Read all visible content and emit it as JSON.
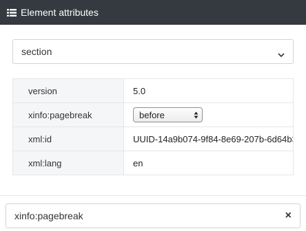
{
  "header": {
    "title": "Element attributes",
    "icon": "list-icon"
  },
  "element_select": {
    "value": "section",
    "icon": "chevron-down-icon"
  },
  "attributes": [
    {
      "key": "version",
      "value": "5.0"
    },
    {
      "key": "xinfo:pagebreak",
      "value": "before"
    },
    {
      "key": "xml:id",
      "value": "UUID-14a9b074-9f84-8e69-207b-6d64b3"
    },
    {
      "key": "xml:lang",
      "value": "en"
    }
  ],
  "search": {
    "value": "xinfo:pagebreak",
    "clear_icon": "close-icon",
    "clear_label": "×"
  },
  "colors": {
    "header_bg": "#343a40",
    "key_bg": "#f5f6f7",
    "border": "#e3e6ea"
  }
}
